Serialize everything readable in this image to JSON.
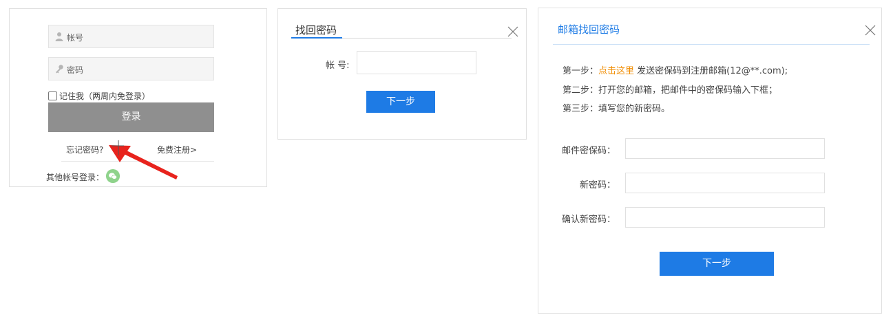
{
  "login": {
    "username_placeholder": "帐号",
    "password_placeholder": "密码",
    "remember_label": "记住我（两周内免登录）",
    "login_button": "登录",
    "forgot_link": "忘记密码?",
    "register_link": "免费注册>",
    "other_login_label": "其他帐号登录：",
    "icons": {
      "user": "user-icon",
      "key": "key-icon",
      "wechat": "wechat-icon"
    }
  },
  "find_password": {
    "title": "找回密码",
    "account_label": "帐 号:",
    "next_button": "下一步"
  },
  "email_recovery": {
    "title": "邮箱找回密码",
    "step1_prefix": "第一步：",
    "step1_link": "点击这里",
    "step1_suffix": " 发送密保码到注册邮箱(12@**.com);",
    "step2": "第二步：打开您的邮箱，把邮件中的密保码输入下框；",
    "step3": "第三步：填写您的新密码。",
    "code_label": "邮件密保码：",
    "new_password_label": "新密码：",
    "confirm_password_label": "确认新密码：",
    "next_button": "下一步"
  },
  "colors": {
    "accent": "#1e7be5",
    "link_highlight": "#f08c00",
    "login_button": "#8f8f8f",
    "annotation_arrow": "#e8231d"
  }
}
